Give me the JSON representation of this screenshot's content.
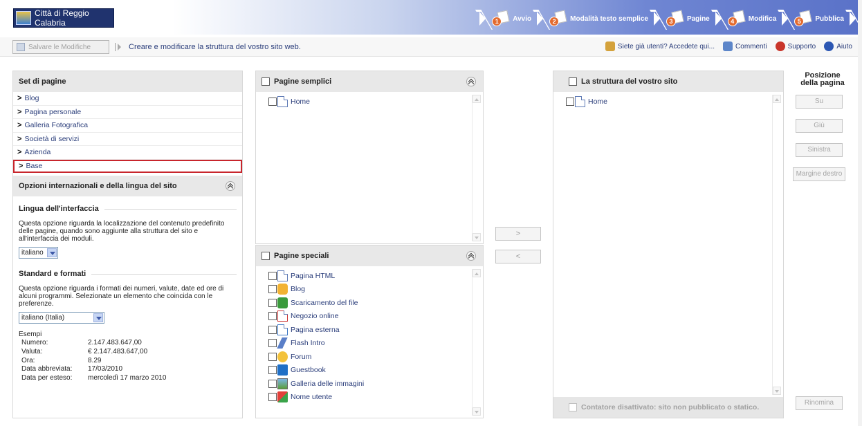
{
  "header": {
    "logo_text": "Città di Reggio Calabria",
    "steps": [
      {
        "num": "1",
        "label": "Avvio",
        "color": "#e36a2e"
      },
      {
        "num": "2",
        "label": "Modalità testo semplice",
        "color": "#e36a2e"
      },
      {
        "num": "3",
        "label": "Pagine",
        "color": "#e36a2e"
      },
      {
        "num": "4",
        "label": "Modifica",
        "color": "#e36a2e"
      },
      {
        "num": "5",
        "label": "Pubblica",
        "color": "#e36a2e"
      }
    ]
  },
  "toolbar": {
    "save_label": "Salvare le Modifiche",
    "hint": "Creare e modificare la struttura del vostro sito web.",
    "links": [
      {
        "label": "Siete già utenti? Accedete qui...",
        "icon": "user-key-icon"
      },
      {
        "label": "Commenti",
        "icon": "comment-icon"
      },
      {
        "label": "Supporto",
        "icon": "support-icon"
      },
      {
        "label": "Aiuto",
        "icon": "help-icon"
      }
    ]
  },
  "left": {
    "title": "Set di pagine",
    "sets": [
      "Blog",
      "Pagina personale",
      "Galleria Fotografica",
      "Società di servizi",
      "Azienda",
      "Base"
    ],
    "selected_set": "Base",
    "options_title": "Opzioni internazionali e della lingua del sito",
    "lang_section": {
      "title": "Lingua dell'interfaccia",
      "text": "Questa opzione riguarda la localizzazione del contenuto predefinito delle pagine, quando sono aggiunte alla struttura del sito e all'interfaccia dei moduli.",
      "value": "italiano"
    },
    "format_section": {
      "title": "Standard e formati",
      "text": "Questa opzione riguarda i formati dei numeri, valute, date ed ore di alcuni programmi. Selezionate un elemento che coincida con le preferenze.",
      "value": "italiano (Italia)"
    },
    "examples": {
      "title": "Esempi",
      "rows": [
        {
          "k": "Numero:",
          "v": "2.147.483.647,00"
        },
        {
          "k": "Valuta:",
          "v": "€ 2.147.483.647,00"
        },
        {
          "k": "Ora:",
          "v": "8.29"
        },
        {
          "k": "Data abbreviata:",
          "v": "17/03/2010"
        },
        {
          "k": "Data per esteso:",
          "v": "mercoledì 17 marzo 2010"
        }
      ]
    }
  },
  "simple_pages": {
    "title": "Pagine semplici",
    "items": [
      "Home"
    ]
  },
  "special_pages": {
    "title": "Pagine speciali",
    "items": [
      {
        "label": "Pagina HTML",
        "icon": "page-icon"
      },
      {
        "label": "Blog",
        "icon": "blog-icon"
      },
      {
        "label": "Scaricamento del file",
        "icon": "download-icon"
      },
      {
        "label": "Negozio online",
        "icon": "shop-icon"
      },
      {
        "label": "Pagina esterna",
        "icon": "external-page-icon"
      },
      {
        "label": "Flash Intro",
        "icon": "flash-icon"
      },
      {
        "label": "Forum",
        "icon": "forum-icon"
      },
      {
        "label": "Guestbook",
        "icon": "guestbook-icon"
      },
      {
        "label": "Galleria delle immagini",
        "icon": "gallery-icon"
      },
      {
        "label": "Nome utente",
        "icon": "user-icon"
      }
    ]
  },
  "transfer": {
    "add": ">",
    "remove": "<"
  },
  "structure": {
    "title": "La struttura del vostro sito",
    "items": [
      "Home"
    ],
    "counter": "Contatore disattivato: sito non pubblicato o statico."
  },
  "position": {
    "title_line1": "Posizione",
    "title_line2": "della pagina",
    "up": "Su",
    "down": "Giù",
    "left": "Sinistra",
    "right": "Margine destro",
    "rename": "Rinomina"
  }
}
